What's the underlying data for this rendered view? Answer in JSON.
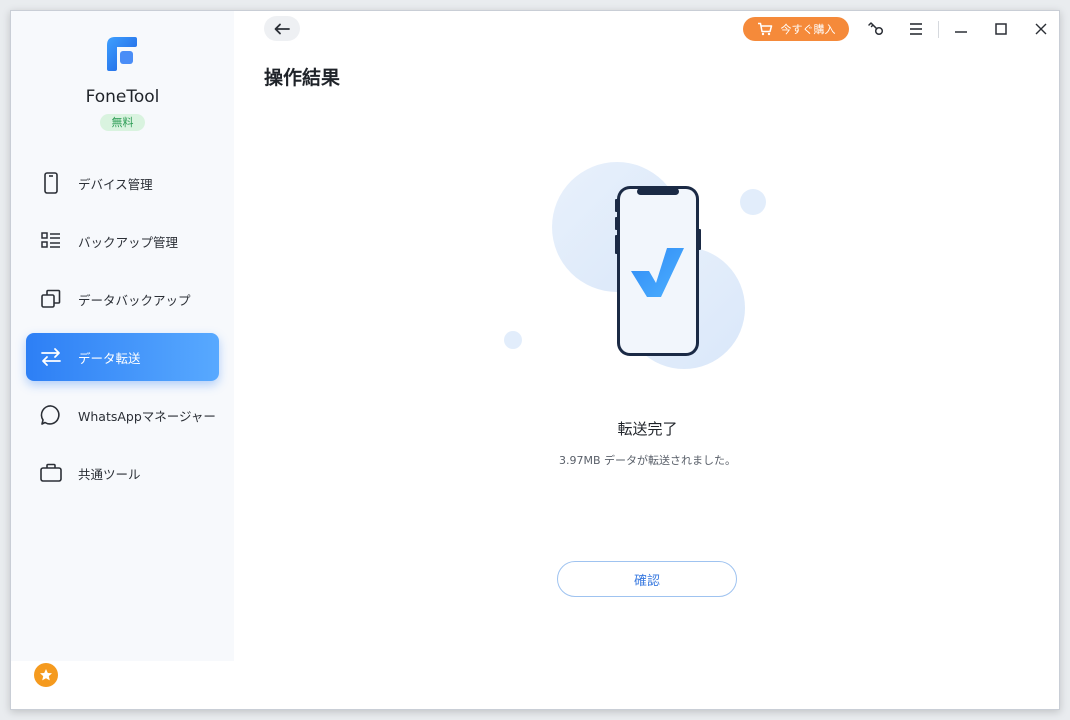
{
  "app": {
    "name": "FoneTool",
    "badge": "無料"
  },
  "sidebar": {
    "items": [
      {
        "label": "デバイス管理",
        "icon": "phone-icon"
      },
      {
        "label": "バックアップ管理",
        "icon": "list-icon"
      },
      {
        "label": "データバックアップ",
        "icon": "copy-icon"
      },
      {
        "label": "データ転送",
        "icon": "transfer-icon",
        "active": true
      },
      {
        "label": "WhatsAppマネージャー",
        "icon": "chat-icon"
      },
      {
        "label": "共通ツール",
        "icon": "briefcase-icon"
      }
    ]
  },
  "toolbar": {
    "buy_label": "今すぐ購入"
  },
  "main": {
    "title": "操作結果",
    "result_title": "転送完了",
    "result_desc": "3.97MB データが転送されました。",
    "confirm_label": "確認"
  },
  "colors": {
    "accent": "#2d7ff5",
    "buy": "#f58a3a",
    "badge_bg": "#d9f3df",
    "badge_text": "#2f9e57",
    "star": "#f59a1e"
  }
}
